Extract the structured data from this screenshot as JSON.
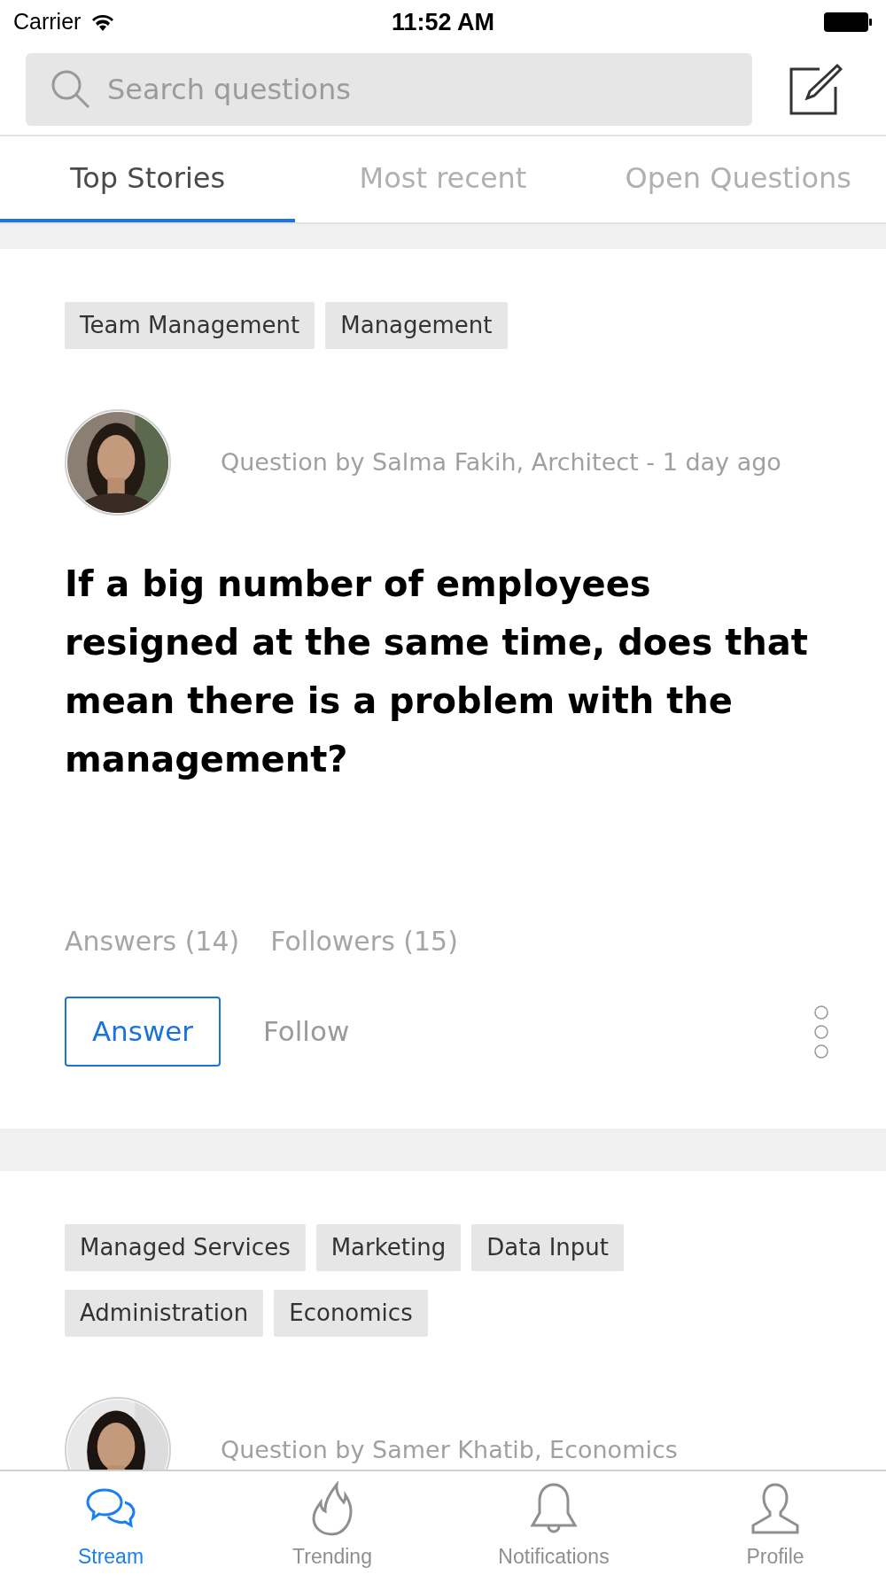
{
  "status_bar": {
    "carrier": "Carrier",
    "time": "11:52 AM"
  },
  "search": {
    "placeholder": "Search questions"
  },
  "tabs": [
    {
      "label": "Top Stories",
      "selected": true
    },
    {
      "label": "Most recent",
      "selected": false
    },
    {
      "label": "Open Questions",
      "selected": false
    }
  ],
  "posts": [
    {
      "tags": [
        "Team Management",
        "Management"
      ],
      "author_line": "Question by Salma Fakih, Architect - 1 day ago",
      "question": "If a big number of employees resigned at the same time, does that mean there is a problem with the management?",
      "answers": "Answers (14)",
      "followers": "Followers (15)",
      "answer_button": "Answer",
      "follow_button": "Follow"
    },
    {
      "tags": [
        "Managed Services",
        "Marketing",
        "Data Input",
        "Administration",
        "Economics"
      ],
      "author_line": "Question by Samer Khatib, Economics"
    }
  ],
  "bottom_nav": [
    {
      "label": "Stream",
      "selected": true
    },
    {
      "label": "Trending",
      "selected": false
    },
    {
      "label": "Notifications",
      "selected": false
    },
    {
      "label": "Profile",
      "selected": false
    }
  ]
}
